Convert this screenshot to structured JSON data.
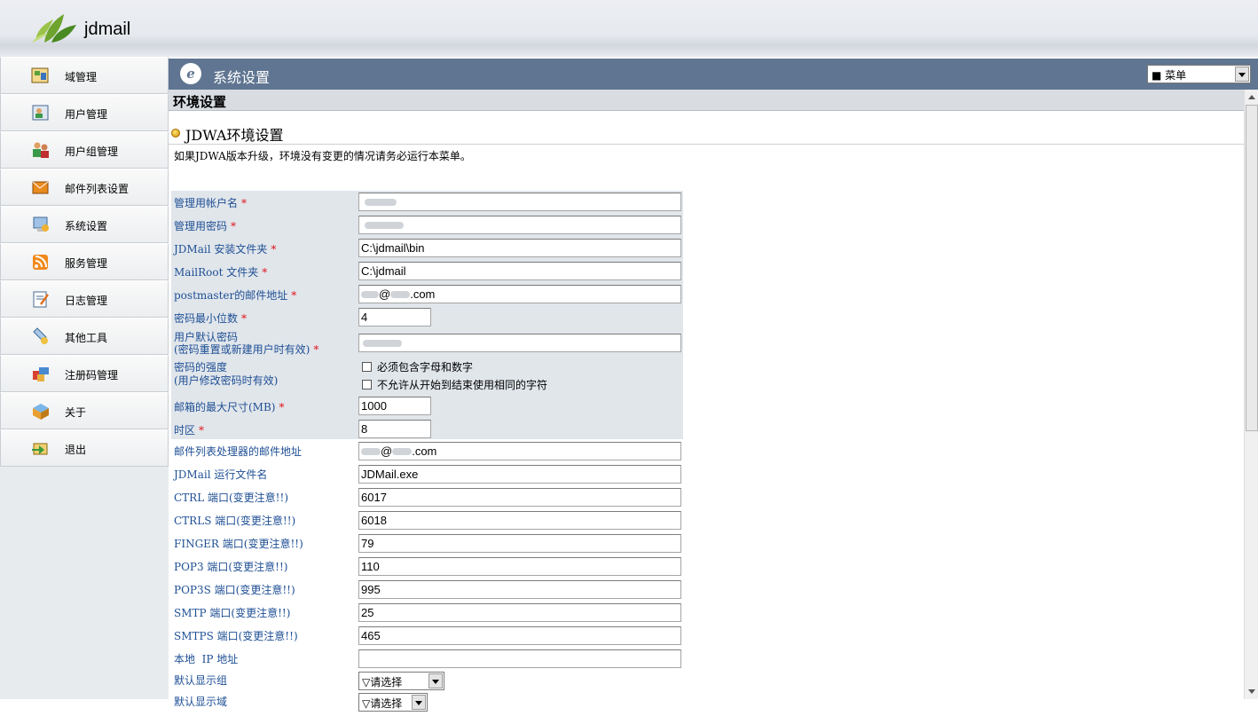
{
  "app": {
    "logo_text": "jdmail"
  },
  "sidebar": {
    "items": [
      {
        "label": "域管理",
        "icon": "domain-icon"
      },
      {
        "label": "用户管理",
        "icon": "user-icon"
      },
      {
        "label": "用户组管理",
        "icon": "user-group-icon"
      },
      {
        "label": "邮件列表设置",
        "icon": "mailing-list-icon"
      },
      {
        "label": "系统设置",
        "icon": "system-settings-icon"
      },
      {
        "label": "服务管理",
        "icon": "rss-service-icon"
      },
      {
        "label": "日志管理",
        "icon": "log-icon"
      },
      {
        "label": "其他工具",
        "icon": "tools-icon"
      },
      {
        "label": "注册码管理",
        "icon": "registration-icon"
      },
      {
        "label": "关于",
        "icon": "about-icon"
      },
      {
        "label": "退出",
        "icon": "logout-icon"
      }
    ]
  },
  "titlebar": {
    "title": "系统设置",
    "menu_select": "■ 菜单"
  },
  "section": {
    "title": "环境设置"
  },
  "panel": {
    "subtitle": "JDWA环境设置",
    "note": "如果JDWA版本升级，环境没有变更的情况请务必运行本菜单。"
  },
  "form": {
    "required_mark": "*",
    "fields": [
      {
        "label": "管理用帐户名",
        "required": true,
        "value": "admin"
      },
      {
        "label": "管理用密码",
        "required": true,
        "value": "•••••••"
      },
      {
        "label": "JDMail 安装文件夹",
        "required": true,
        "value": "C:\\jdmail\\bin"
      },
      {
        "label": "MailRoot 文件夹",
        "required": true,
        "value": "C:\\jdmail"
      },
      {
        "label": "postmaster的邮件地址",
        "required": true,
        "value_at": "@",
        "value_suffix": ".com"
      },
      {
        "label": "密码最小位数",
        "required": true,
        "value": "4"
      },
      {
        "label_line1": "用户默认密码",
        "label_line2": "(密码重置或新建用户时有效)",
        "required": true,
        "value": ""
      },
      {
        "label_line1": "密码的强度",
        "label_line2": "(用户修改密码时有效)",
        "check1": "必须包含字母和数字",
        "check2": "不允许从开始到结束使用相同的字符"
      },
      {
        "label": "邮箱的最大尺寸(MB)",
        "required": true,
        "value": "1000"
      },
      {
        "label": "时区",
        "required": true,
        "value": "8"
      },
      {
        "label": "邮件列表处理器的邮件地址",
        "value_at": "@",
        "value_suffix": ".com"
      },
      {
        "label": "JDMail 运行文件名",
        "value": "JDMail.exe"
      },
      {
        "label": "CTRL 端口(变更注意!!)",
        "value": "6017"
      },
      {
        "label": "CTRLS 端口(变更注意!!)",
        "value": "6018"
      },
      {
        "label": "FINGER 端口(变更注意!!)",
        "value": "79"
      },
      {
        "label": "POP3 端口(变更注意!!)",
        "value": "110"
      },
      {
        "label": "POP3S 端口(变更注意!!)",
        "value": "995"
      },
      {
        "label": "SMTP 端口(变更注意!!)",
        "value": "25"
      },
      {
        "label": "SMTPS 端口(变更注意!!)",
        "value": "465"
      },
      {
        "label": "本地  IP 地址",
        "value": ""
      },
      {
        "label": "默认显示组",
        "select": "▽请选择"
      },
      {
        "label": "默认显示域",
        "select": "▽请选择"
      }
    ]
  },
  "colors": {
    "titlebar": "#5f7591",
    "label_text": "#1e4f94",
    "required": "#e0151c",
    "shaded_row": "#e1e6eb"
  }
}
